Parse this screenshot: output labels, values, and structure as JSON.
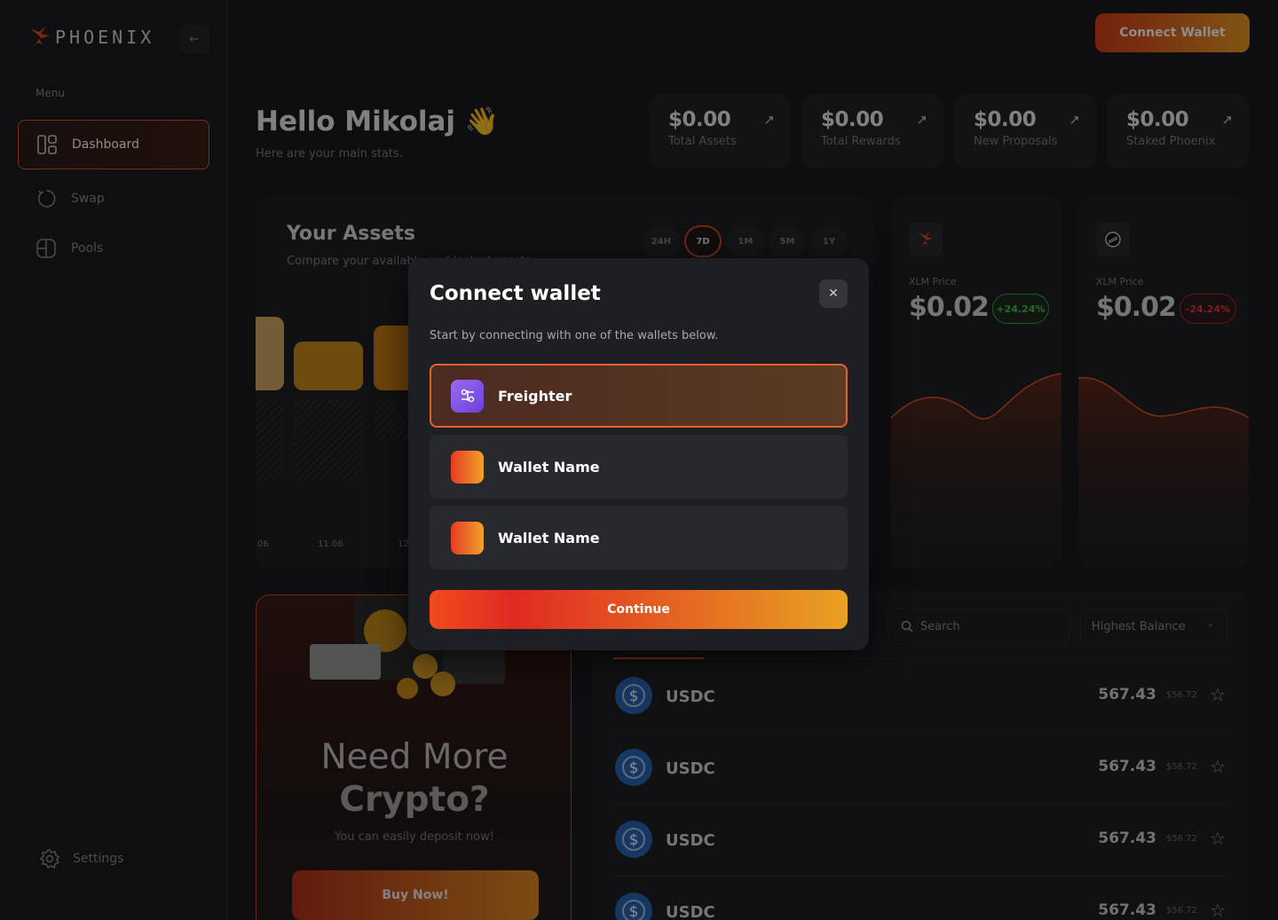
{
  "brand": {
    "name": "PHOENIX"
  },
  "sidebar": {
    "menu_label": "Menu",
    "items": [
      {
        "label": "Dashboard",
        "icon": "dashboard-icon",
        "active": true
      },
      {
        "label": "Swap",
        "icon": "swap-icon",
        "active": false
      },
      {
        "label": "Pools",
        "icon": "pools-icon",
        "active": false
      }
    ],
    "settings_label": "Settings"
  },
  "header": {
    "connect_label": "Connect Wallet"
  },
  "greeting": {
    "title": "Hello Mikolaj 👋",
    "subtitle": "Here are your main stats."
  },
  "stats": [
    {
      "value": "$0.00",
      "label": "Total Assets"
    },
    {
      "value": "$0.00",
      "label": "Total Rewards"
    },
    {
      "value": "$0.00",
      "label": "New Proposals"
    },
    {
      "value": "$0.00",
      "label": "Staked Phoenix"
    }
  ],
  "assets": {
    "title": "Your Assets",
    "subtitle": "Compare your available and locked assets",
    "ranges": [
      "24H",
      "7D",
      "1M",
      "5M",
      "1Y"
    ],
    "active_range": "7D",
    "x_ticks": [
      "06",
      "11.06",
      "12"
    ]
  },
  "prices": [
    {
      "label": "XLM Price",
      "value": "$0.02",
      "change": "+24.24%",
      "direction": "up",
      "icon": "phoenix-icon"
    },
    {
      "label": "XLM Price",
      "value": "$0.02",
      "change": "-24.24%",
      "direction": "down",
      "icon": "stellar-icon"
    }
  ],
  "promo": {
    "title_line1": "Need More",
    "title_line2": "Crypto?",
    "subtitle": "You can easily deposit now!",
    "button": "Buy Now!"
  },
  "tokens": {
    "search_placeholder": "Search",
    "sort_label": "Highest Balance",
    "rows": [
      {
        "name": "USDC",
        "amount": "567.43",
        "usd": "$56.72"
      },
      {
        "name": "USDC",
        "amount": "567.43",
        "usd": "$56.72"
      },
      {
        "name": "USDC",
        "amount": "567.43",
        "usd": "$56.72"
      },
      {
        "name": "USDC",
        "amount": "567.43",
        "usd": "$56.72"
      }
    ]
  },
  "modal": {
    "title": "Connect wallet",
    "subtitle": "Start by connecting with one of the wallets below.",
    "wallets": [
      {
        "name": "Freighter",
        "selected": true
      },
      {
        "name": "Wallet Name",
        "selected": false
      },
      {
        "name": "Wallet Name",
        "selected": false
      }
    ],
    "continue_label": "Continue"
  },
  "colors": {
    "accent": "#e2522a",
    "accent_gold": "#e9a223",
    "up": "#41c24e",
    "down": "#e23a3a"
  }
}
